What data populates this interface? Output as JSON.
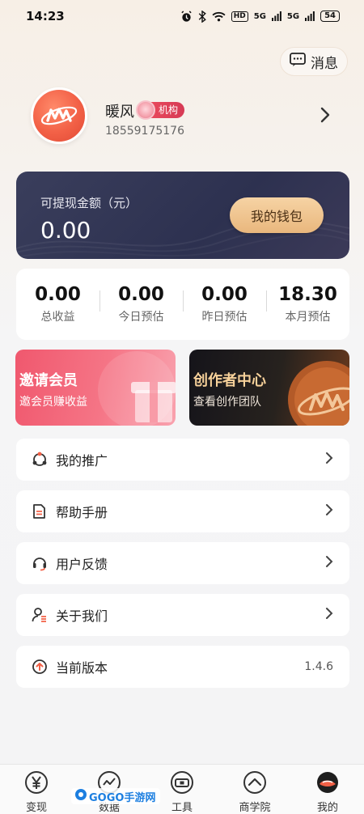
{
  "status_bar": {
    "time": "14:23",
    "hd": "HD",
    "signal_1": "5G",
    "signal_2": "5G",
    "battery": "54"
  },
  "header": {
    "messages_label": "消息"
  },
  "profile": {
    "name": "暖风",
    "badge": "机构",
    "phone": "18559175176"
  },
  "wallet": {
    "label": "可提现金额（元）",
    "amount": "0.00",
    "button": "我的钱包"
  },
  "stats": [
    {
      "value": "0.00",
      "label": "总收益"
    },
    {
      "value": "0.00",
      "label": "今日预估"
    },
    {
      "value": "0.00",
      "label": "昨日预估"
    },
    {
      "value": "18.30",
      "label": "本月预估"
    }
  ],
  "promos": {
    "invite": {
      "title": "邀请会员",
      "subtitle": "邀会员赚收益"
    },
    "creator": {
      "title": "创作者中心",
      "subtitle": "查看创作团队"
    }
  },
  "menu": [
    {
      "label": "我的推广",
      "icon": "share-icon"
    },
    {
      "label": "帮助手册",
      "icon": "manual-icon"
    },
    {
      "label": "用户反馈",
      "icon": "headset-icon"
    },
    {
      "label": "关于我们",
      "icon": "about-icon"
    },
    {
      "label": "当前版本",
      "icon": "upload-icon",
      "value": "1.4.6"
    }
  ],
  "tabs": [
    {
      "label": "变现",
      "icon": "yen-icon"
    },
    {
      "label": "数据",
      "icon": "chart-icon"
    },
    {
      "label": "工具",
      "icon": "toolbox-icon"
    },
    {
      "label": "商学院",
      "icon": "academy-icon"
    },
    {
      "label": "我的",
      "icon": "profile-logo-icon",
      "active": true
    }
  ],
  "watermark": {
    "text": "GOGO手游网"
  },
  "colors": {
    "accent_red": "#f26046",
    "wallet_bg": "#2d3150",
    "wallet_button": "#e9b77d",
    "invite_pink": "#f0586e",
    "creator_gold": "#f7d19a"
  }
}
